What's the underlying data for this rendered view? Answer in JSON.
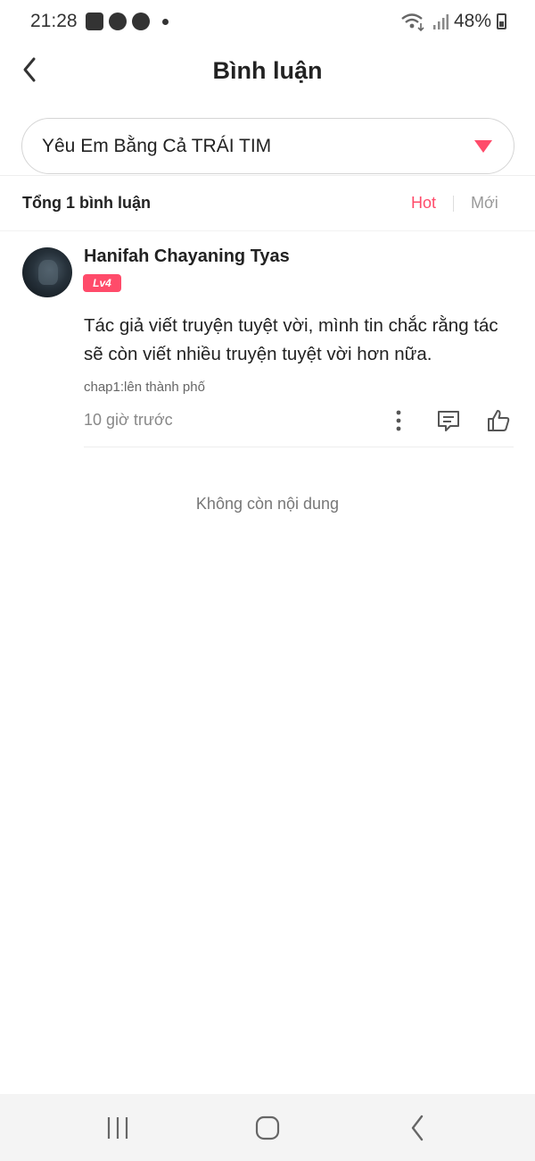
{
  "status_bar": {
    "time": "21:28",
    "battery_text": "48%",
    "left_icons": [
      "gallery-icon",
      "browser-icon",
      "facebook-icon",
      "notification-dot-icon"
    ],
    "right_icons": [
      "wifi-icon",
      "signal-icon",
      "battery-icon"
    ]
  },
  "header": {
    "title": "Bình luận",
    "back_icon": "chevron-left-icon"
  },
  "book_selector": {
    "value": "Yêu Em Bằng Cả TRÁI TIM",
    "icon": "triangle-down-icon"
  },
  "summary": {
    "count_label": "Tổng 1 bình luận",
    "sort_options": [
      "Hot",
      "Mới"
    ],
    "active_sort": "Hot"
  },
  "comments": [
    {
      "username": "Hanifah Chayaning Tyas",
      "level": "Lv4",
      "text": "Tác giả viết truyện tuyệt vời, mình tin chắc rằng tác sẽ còn viết nhiều truyện tuyệt vời hơn nữa.",
      "chapter": "chap1:lên thành phố",
      "time": "10 giờ trước"
    }
  ],
  "end_message": "Không còn nội dung",
  "colors": {
    "accent": "#ff4b6a",
    "text_primary": "#222222",
    "text_muted": "#888888",
    "nav_background": "#f4f4f4"
  }
}
